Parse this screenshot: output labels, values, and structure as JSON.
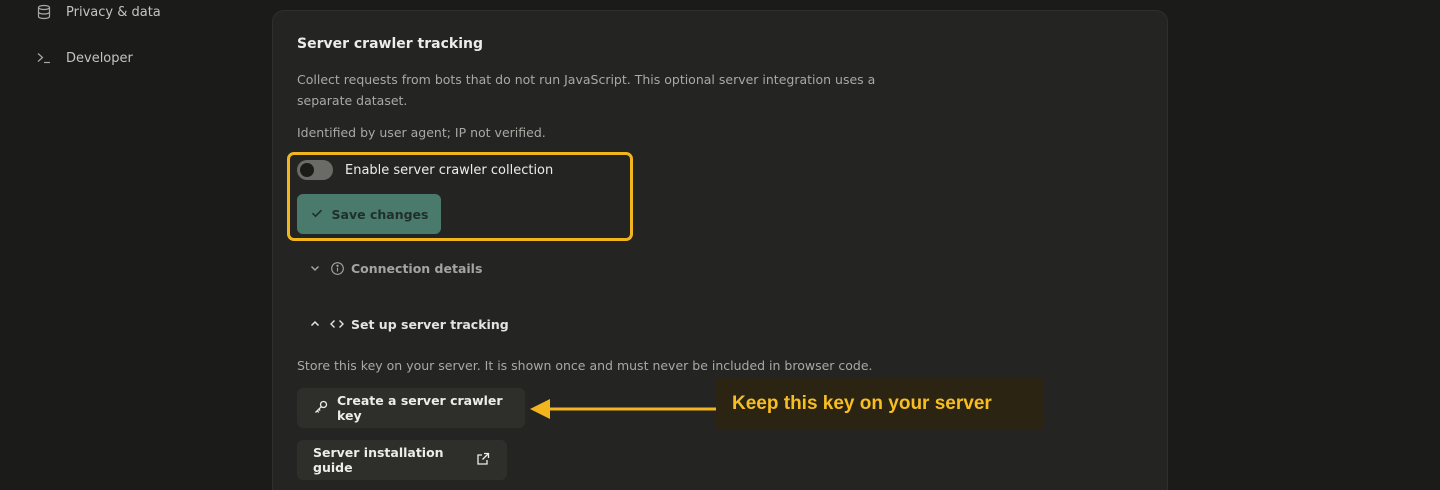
{
  "sidebar": {
    "items": [
      {
        "label": "Privacy & data",
        "icon": "database-icon"
      },
      {
        "label": "Developer",
        "icon": "terminal-icon"
      }
    ]
  },
  "card": {
    "title": "Server crawler tracking",
    "description": "Collect requests from bots that do not run JavaScript. This optional server integration uses a separate dataset.",
    "note": "Identified by user agent; IP not verified.",
    "toggle": {
      "label": "Enable server crawler collection",
      "enabled": false
    },
    "save_button": {
      "label": "Save changes",
      "icon": "check-icon"
    },
    "connection_details": {
      "label": "Connection details",
      "expanded": false
    },
    "setup": {
      "label": "Set up server tracking",
      "expanded": true
    },
    "key_note": "Store this key on your server. It is shown once and must never be included in browser code.",
    "create_key_button": {
      "label": "Create a server crawler key",
      "icon": "key-icon"
    },
    "guide_button": {
      "label": "Server installation guide",
      "icon": "external-link-icon"
    }
  },
  "annotation": {
    "callout": "Keep this key on your server",
    "accent_color": "#f2b51d"
  }
}
